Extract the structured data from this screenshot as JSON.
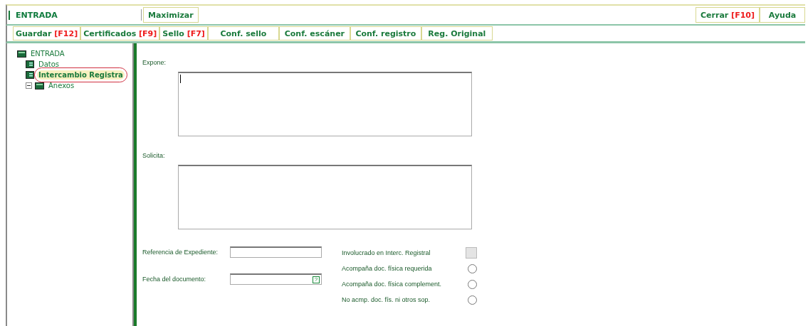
{
  "window": {
    "title": "ENTRADA",
    "actions": [
      {
        "label": "Maximizar"
      }
    ],
    "right_actions": [
      {
        "label": "Cerrar",
        "key": "[F10]"
      },
      {
        "label": "Ayuda"
      }
    ]
  },
  "toolbar": [
    {
      "label": "Guardar",
      "key": "[F12]"
    },
    {
      "label": "Certificados",
      "key": "[F9]"
    },
    {
      "label": "Sello",
      "key": "[F7]"
    },
    {
      "label": "Conf. sello"
    },
    {
      "label": "Conf. escáner"
    },
    {
      "label": "Conf. registro"
    },
    {
      "label": "Reg. Original"
    }
  ],
  "tree": [
    {
      "label": "ENTRADA",
      "selected": false,
      "kind": "root",
      "children": [
        {
          "label": "Datos",
          "selected": false,
          "kind": "page"
        },
        {
          "label": "Intercambio Registra",
          "selected": true,
          "kind": "page"
        },
        {
          "label": "Anexos",
          "selected": false,
          "kind": "folder",
          "expanded": true
        }
      ]
    }
  ],
  "form": {
    "text_areas": [
      {
        "label": "Expone:",
        "cursor": true
      },
      {
        "label": "Solicita:",
        "cursor": false
      }
    ],
    "fields": [
      {
        "label": "Referencia de Expediente:"
      },
      {
        "label": "Fecha del documento:",
        "help": "?"
      }
    ],
    "options": [
      {
        "label": "Involucrado en Interc. Registral",
        "kind": "checkbox",
        "checked": false,
        "disabled": true
      },
      {
        "label": "Acompaña doc. física requerida",
        "kind": "radio",
        "selected": false
      },
      {
        "label": "Acompaña doc. física complement.",
        "kind": "radio",
        "selected": false
      },
      {
        "label": "No acmp. doc. fís. ni otros sop.",
        "kind": "radio",
        "selected": false
      }
    ]
  }
}
